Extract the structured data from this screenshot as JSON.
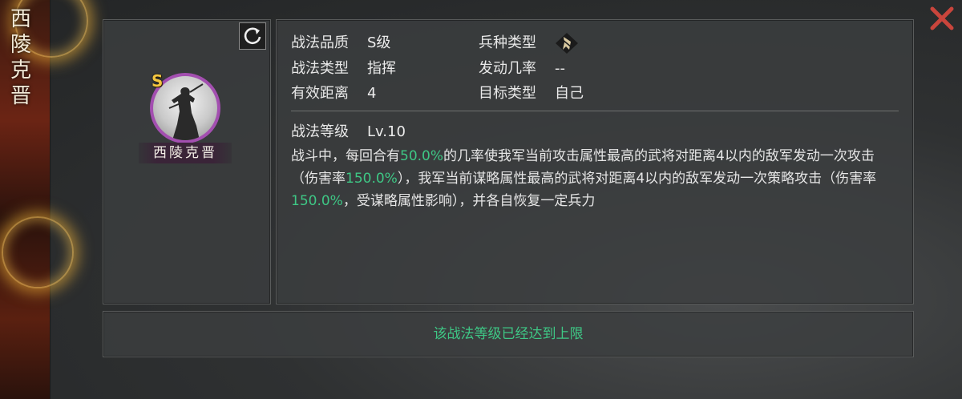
{
  "side_title": [
    "西",
    "陵",
    "克",
    "晋"
  ],
  "portrait": {
    "grade": "S",
    "name": "西陵克晋"
  },
  "attrs": {
    "quality_label": "战法品质",
    "quality_value": "S级",
    "type_label": "战法类型",
    "type_value": "指挥",
    "range_label": "有效距离",
    "range_value": "4",
    "troop_label": "兵种类型",
    "rate_label": "发动几率",
    "rate_value": "--",
    "target_label": "目标类型",
    "target_value": "自己",
    "level_label": "战法等级",
    "level_value": "Lv.10"
  },
  "description": {
    "p1": "战斗中，每回合有",
    "v1": "50.0%",
    "p2": "的几率使我军当前攻击属性最高的武将对距离4以内的敌军发动一次攻击（伤害率",
    "v2": "150.0%",
    "p3": "），我军当前谋略属性最高的武将对距离4以内的敌军发动一次策略攻击（伤害率",
    "v3": "150.0%",
    "p4": "，受谋略属性影响），并各自恢复一定兵力"
  },
  "bottom_message": "该战法等级已经达到上限",
  "icons": {
    "close": "close-icon",
    "refresh": "refresh-icon",
    "troop": "troop-type-icon"
  },
  "colors": {
    "highlight": "#3ec785",
    "grade_gold": "#f4c640",
    "portrait_ring": "#a34fb0",
    "close_red": "#c9453c"
  }
}
